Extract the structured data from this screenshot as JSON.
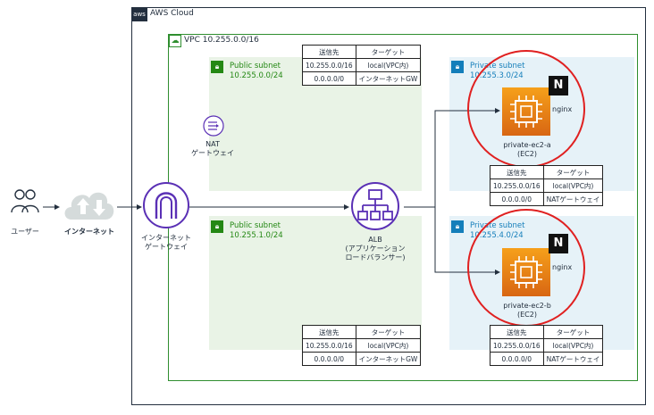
{
  "cloud": {
    "label": "AWS Cloud",
    "logo": "aws"
  },
  "vpc": {
    "label": "VPC 10.255.0.0/16"
  },
  "user": {
    "label": "ユーザー"
  },
  "internet": {
    "label": "インターネット"
  },
  "igw": {
    "label_line1": "インターネット",
    "label_line2": "ゲートウェイ"
  },
  "nat": {
    "label_line1": "NAT",
    "label_line2": "ゲートウェイ"
  },
  "alb": {
    "label_line1": "ALB",
    "label_line2": "(アプリケーション",
    "label_line3": "ロードバランサー)"
  },
  "subnets": {
    "public_a": {
      "name": "Public subnet",
      "cidr": "10.255.0.0/24"
    },
    "public_b": {
      "name": "Public subnet",
      "cidr": "10.255.1.0/24"
    },
    "private_a": {
      "name": "Private subnet",
      "cidr": "10.255.3.0/24"
    },
    "private_b": {
      "name": "Private subnet",
      "cidr": "10.255.4.0/24"
    }
  },
  "ec2_a": {
    "name": "private-ec2-a",
    "type": "(EC2)",
    "nginx_logo": "N",
    "nginx_label": "nginx"
  },
  "ec2_b": {
    "name": "private-ec2-b",
    "type": "(EC2)",
    "nginx_logo": "N",
    "nginx_label": "nginx"
  },
  "route_tables": {
    "headers": {
      "dest": "送信先",
      "target": "ターゲット"
    },
    "public": [
      {
        "dest": "10.255.0.0/16",
        "target": "local(VPC内)"
      },
      {
        "dest": "0.0.0.0/0",
        "target": "インターネットGW"
      }
    ],
    "private": [
      {
        "dest": "10.255.0.0/16",
        "target": "local(VPC内)"
      },
      {
        "dest": "0.0.0.0/0",
        "target": "NATゲートウェイ"
      }
    ]
  },
  "colors": {
    "public": "#248814",
    "private": "#147eba",
    "ec2": "#ed7100",
    "highlight": "#e02020",
    "icon_purple": "#5a30b5"
  }
}
